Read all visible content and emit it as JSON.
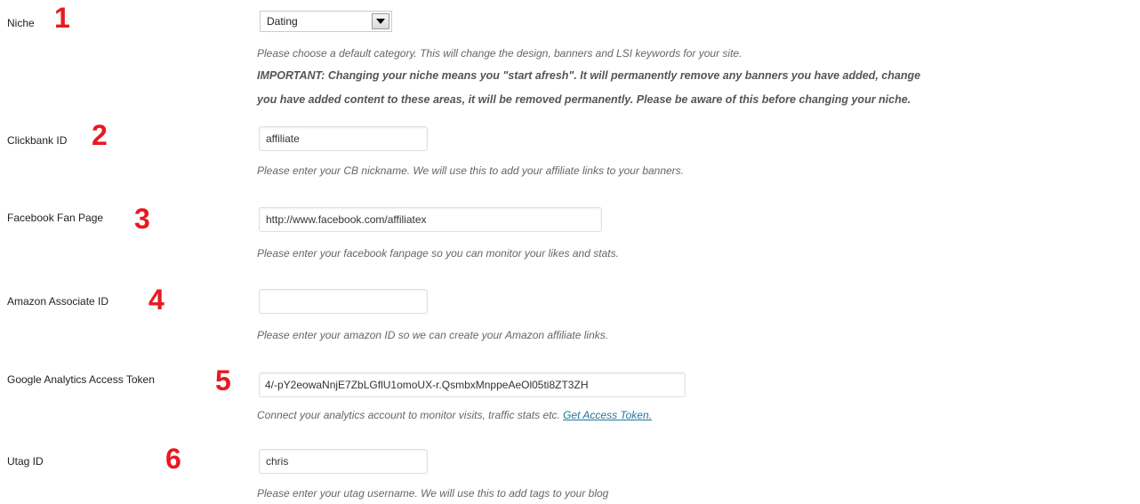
{
  "niche": {
    "label": "Niche",
    "number": "1",
    "selected": "Dating",
    "desc": "Please choose a default category. This will change the design, banners and LSI keywords for your site.",
    "important_line1": "IMPORTANT: Changing your niche means you \"start afresh\". It will permanently remove any banners you have added, change",
    "important_line2": "you have added content to these areas, it will be removed permanently. Please be aware of this before changing your niche."
  },
  "clickbank": {
    "label": "Clickbank ID",
    "number": "2",
    "value": "affiliate",
    "desc": "Please enter your CB nickname. We will use this to add your affiliate links to your banners."
  },
  "facebook": {
    "label": "Facebook Fan Page",
    "number": "3",
    "value": "http://www.facebook.com/affiliatex",
    "desc": "Please enter your facebook fanpage so you can monitor your likes and stats."
  },
  "amazon": {
    "label": "Amazon Associate ID",
    "number": "4",
    "value": "",
    "desc": "Please enter your amazon ID so we can create your Amazon affiliate links."
  },
  "google": {
    "label": "Google Analytics Access Token",
    "number": "5",
    "value": "4/-pY2eowaNnjE7ZbLGflU1omoUX-r.QsmbxMnppeAeOl05ti8ZT3ZH",
    "desc": "Connect your analytics account to monitor visits, traffic stats etc.",
    "link_text": "Get Access Token."
  },
  "utag": {
    "label": "Utag ID",
    "number": "6",
    "value": "chris",
    "desc": "Please enter your utag username. We will use this to add tags to your blog"
  },
  "colors": {
    "number_red": "#e8191f",
    "link_blue": "#21759b"
  },
  "icons": {
    "select_arrow": "chevron-down-icon"
  }
}
